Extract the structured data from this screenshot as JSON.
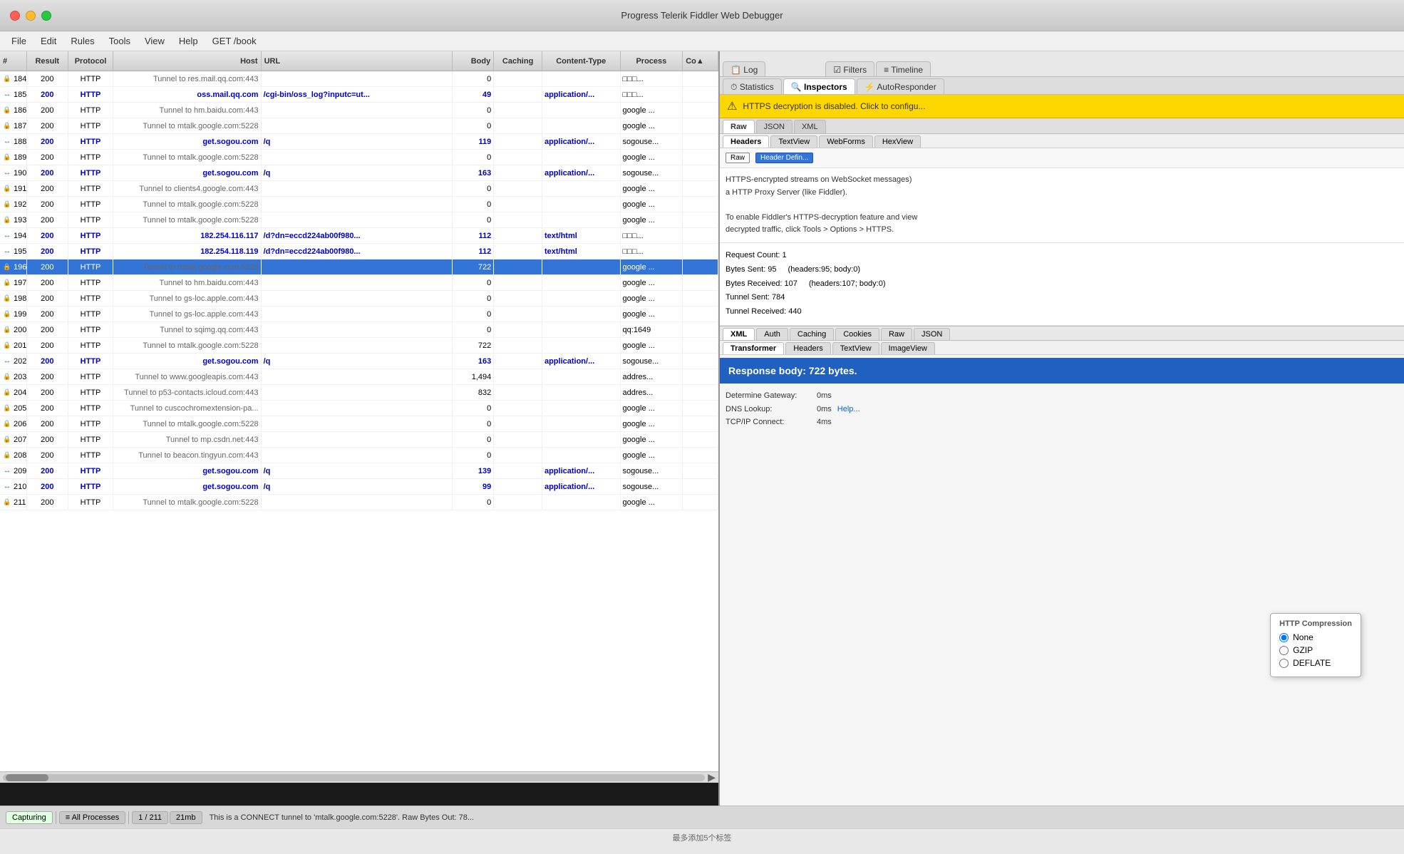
{
  "titleBar": {
    "title": "Progress Telerik Fiddler Web Debugger"
  },
  "menuBar": {
    "items": [
      "File",
      "Edit",
      "Rules",
      "Tools",
      "View",
      "Help",
      "GET /book"
    ]
  },
  "columns": {
    "headers": [
      "#",
      "Result",
      "Protocol",
      "Host",
      "URL",
      "Body",
      "Caching",
      "Content-Type",
      "Process",
      "Co▲"
    ]
  },
  "sessions": [
    {
      "num": "184",
      "result": "200",
      "protocol": "HTTP",
      "host": "Tunnel to",
      "hostDetail": "res.mail.qq.com:443",
      "url": "",
      "body": "0",
      "caching": "",
      "contentType": "",
      "process": "□□□...",
      "type": "tunnel"
    },
    {
      "num": "185",
      "result": "200",
      "protocol": "HTTP",
      "host": "oss.mail.qq.com",
      "hostDetail": "",
      "url": "/cgi-bin/oss_log?inputc=ut...",
      "body": "49",
      "caching": "",
      "contentType": "application/...",
      "process": "□□□...",
      "type": "active"
    },
    {
      "num": "186",
      "result": "200",
      "protocol": "HTTP",
      "host": "Tunnel to",
      "hostDetail": "hm.baidu.com:443",
      "url": "",
      "body": "0",
      "caching": "",
      "contentType": "",
      "process": "google ...",
      "type": "tunnel"
    },
    {
      "num": "187",
      "result": "200",
      "protocol": "HTTP",
      "host": "Tunnel to",
      "hostDetail": "mtalk.google.com:5228",
      "url": "",
      "body": "0",
      "caching": "",
      "contentType": "",
      "process": "google ...",
      "type": "tunnel"
    },
    {
      "num": "188",
      "result": "200",
      "protocol": "HTTP",
      "host": "get.sogou.com",
      "hostDetail": "",
      "url": "/q",
      "body": "119",
      "caching": "",
      "contentType": "application/...",
      "process": "sogouse...",
      "type": "active"
    },
    {
      "num": "189",
      "result": "200",
      "protocol": "HTTP",
      "host": "Tunnel to",
      "hostDetail": "mtalk.google.com:5228",
      "url": "",
      "body": "0",
      "caching": "",
      "contentType": "",
      "process": "google ...",
      "type": "tunnel"
    },
    {
      "num": "190",
      "result": "200",
      "protocol": "HTTP",
      "host": "get.sogou.com",
      "hostDetail": "",
      "url": "/q",
      "body": "163",
      "caching": "",
      "contentType": "application/...",
      "process": "sogouse...",
      "type": "active"
    },
    {
      "num": "191",
      "result": "200",
      "protocol": "HTTP",
      "host": "Tunnel to",
      "hostDetail": "clients4.google.com:443",
      "url": "",
      "body": "0",
      "caching": "",
      "contentType": "",
      "process": "google ...",
      "type": "tunnel"
    },
    {
      "num": "192",
      "result": "200",
      "protocol": "HTTP",
      "host": "Tunnel to",
      "hostDetail": "mtalk.google.com:5228",
      "url": "",
      "body": "0",
      "caching": "",
      "contentType": "",
      "process": "google ...",
      "type": "tunnel"
    },
    {
      "num": "193",
      "result": "200",
      "protocol": "HTTP",
      "host": "Tunnel to",
      "hostDetail": "mtalk.google.com:5228",
      "url": "",
      "body": "0",
      "caching": "",
      "contentType": "",
      "process": "google ...",
      "type": "tunnel"
    },
    {
      "num": "194",
      "result": "200",
      "protocol": "HTTP",
      "host": "182.254.116.117",
      "hostDetail": "",
      "url": "/d?dn=eccd224ab00f980...",
      "body": "112",
      "caching": "",
      "contentType": "text/html",
      "process": "□□□...",
      "type": "active-link"
    },
    {
      "num": "195",
      "result": "200",
      "protocol": "HTTP",
      "host": "182.254.118.119",
      "hostDetail": "",
      "url": "/d?dn=eccd224ab00f980...",
      "body": "112",
      "caching": "",
      "contentType": "text/html",
      "process": "□□□...",
      "type": "active-link"
    },
    {
      "num": "196",
      "result": "200",
      "protocol": "HTTP",
      "host": "Tunnel to",
      "hostDetail": "mtalk.google.com:5228",
      "url": "",
      "body": "722",
      "caching": "",
      "contentType": "",
      "process": "google ...",
      "type": "tunnel-selected"
    },
    {
      "num": "197",
      "result": "200",
      "protocol": "HTTP",
      "host": "Tunnel to",
      "hostDetail": "hm.baidu.com:443",
      "url": "",
      "body": "0",
      "caching": "",
      "contentType": "",
      "process": "google ...",
      "type": "tunnel"
    },
    {
      "num": "198",
      "result": "200",
      "protocol": "HTTP",
      "host": "Tunnel to",
      "hostDetail": "gs-loc.apple.com:443",
      "url": "",
      "body": "0",
      "caching": "",
      "contentType": "",
      "process": "google ...",
      "type": "tunnel"
    },
    {
      "num": "199",
      "result": "200",
      "protocol": "HTTP",
      "host": "Tunnel to",
      "hostDetail": "gs-loc.apple.com:443",
      "url": "",
      "body": "0",
      "caching": "",
      "contentType": "",
      "process": "google ...",
      "type": "tunnel"
    },
    {
      "num": "200",
      "result": "200",
      "protocol": "HTTP",
      "host": "Tunnel to",
      "hostDetail": "sqimg.qq.com:443",
      "url": "",
      "body": "0",
      "caching": "",
      "contentType": "",
      "process": "qq:1649",
      "type": "tunnel"
    },
    {
      "num": "201",
      "result": "200",
      "protocol": "HTTP",
      "host": "Tunnel to",
      "hostDetail": "mtalk.google.com:5228",
      "url": "",
      "body": "722",
      "caching": "",
      "contentType": "",
      "process": "google ...",
      "type": "tunnel"
    },
    {
      "num": "202",
      "result": "200",
      "protocol": "HTTP",
      "host": "get.sogou.com",
      "hostDetail": "",
      "url": "/q",
      "body": "163",
      "caching": "",
      "contentType": "application/...",
      "process": "sogouse...",
      "type": "active"
    },
    {
      "num": "203",
      "result": "200",
      "protocol": "HTTP",
      "host": "Tunnel to",
      "hostDetail": "www.googleapis.com:443",
      "url": "",
      "body": "1,494",
      "caching": "",
      "contentType": "",
      "process": "addres...",
      "type": "tunnel"
    },
    {
      "num": "204",
      "result": "200",
      "protocol": "HTTP",
      "host": "Tunnel to",
      "hostDetail": "p53-contacts.icloud.com:443",
      "url": "",
      "body": "832",
      "caching": "",
      "contentType": "",
      "process": "addres...",
      "type": "tunnel"
    },
    {
      "num": "205",
      "result": "200",
      "protocol": "HTTP",
      "host": "Tunnel to",
      "hostDetail": "cuscochromextension-pa...",
      "url": "",
      "body": "0",
      "caching": "",
      "contentType": "",
      "process": "google ...",
      "type": "tunnel"
    },
    {
      "num": "206",
      "result": "200",
      "protocol": "HTTP",
      "host": "Tunnel to",
      "hostDetail": "mtalk.google.com:5228",
      "url": "",
      "body": "0",
      "caching": "",
      "contentType": "",
      "process": "google ...",
      "type": "tunnel"
    },
    {
      "num": "207",
      "result": "200",
      "protocol": "HTTP",
      "host": "Tunnel to",
      "hostDetail": "mp.csdn.net:443",
      "url": "",
      "body": "0",
      "caching": "",
      "contentType": "",
      "process": "google ...",
      "type": "tunnel"
    },
    {
      "num": "208",
      "result": "200",
      "protocol": "HTTP",
      "host": "Tunnel to",
      "hostDetail": "beacon.tingyun.com:443",
      "url": "",
      "body": "0",
      "caching": "",
      "contentType": "",
      "process": "google ...",
      "type": "tunnel"
    },
    {
      "num": "209",
      "result": "200",
      "protocol": "HTTP",
      "host": "get.sogou.com",
      "hostDetail": "",
      "url": "/q",
      "body": "139",
      "caching": "",
      "contentType": "application/...",
      "process": "sogouse...",
      "type": "active"
    },
    {
      "num": "210",
      "result": "200",
      "protocol": "HTTP",
      "host": "get.sogou.com",
      "hostDetail": "",
      "url": "/q",
      "body": "99",
      "caching": "",
      "contentType": "application/...",
      "process": "sogouse...",
      "type": "active"
    },
    {
      "num": "211",
      "result": "200",
      "protocol": "HTTP",
      "host": "Tunnel to",
      "hostDetail": "mtalk.google.com:5228",
      "url": "",
      "body": "0",
      "caching": "",
      "contentType": "",
      "process": "google ...",
      "type": "tunnel"
    }
  ],
  "rightPanel": {
    "topTabs": [
      {
        "label": "Log",
        "icon": "📋",
        "active": false
      },
      {
        "label": "Filters",
        "icon": "",
        "active": false
      },
      {
        "label": "Timeline",
        "icon": "",
        "active": false
      }
    ],
    "secondTabs": [
      {
        "label": "Statistics",
        "icon": "⏱",
        "active": false
      },
      {
        "label": "Inspectors",
        "icon": "🔍",
        "active": true
      },
      {
        "label": "AutoResponder",
        "icon": "⚡",
        "active": false
      }
    ],
    "warning": "HTTPS decryption is disabled. Click to configu...",
    "topInspectorTabs": [
      "Raw",
      "JSON",
      "XML"
    ],
    "headerTabs": [
      "Headers",
      "TextView",
      "WebForms",
      "HexView"
    ],
    "activeHeaderTab": "Headers",
    "rawTags": [
      "Raw",
      "Header Defin..."
    ],
    "activeRawTag": "Header Defin...",
    "headerContent": "HTTPS-encrypted streams on WebSocket messages)\na HTTP Proxy Server (like Fiddler).",
    "httpsNote": "To enable Fiddler's HTTPS-decryption feature and view\ndecrypted traffic, click Tools > Options > HTTPS.",
    "stats": {
      "requestCount": "Request Count:  1",
      "bytesSent": "Bytes Sent:      95",
      "bytesSentDetail": "(headers:95; body:0)",
      "bytesReceived": "Bytes Received: 107",
      "bytesReceivedDetail": "(headers:107; body:0)",
      "tunnelSent": "Tunnel Sent:    784",
      "tunnelReceived": "Tunnel Received: 440"
    },
    "bottomTabs": [
      "XML",
      "Auth",
      "Caching",
      "Cookies",
      "Raw",
      "JSON"
    ],
    "transformerTabs": [
      "Transformer",
      "Headers",
      "TextView",
      "ImageView"
    ],
    "activeTransformerTab": "Transformer",
    "responseBody": "Response body: 722 bytes.",
    "timings": {
      "gateway": "Determine Gateway:    0ms",
      "dns": "DNS Lookup:    0ms",
      "tcpConnect": "TCP/IP Connect:  4ms"
    },
    "helpLink": "Help...",
    "compression": {
      "title": "HTTP Compression",
      "options": [
        "None",
        "GZIP",
        "DEFLATE"
      ],
      "selected": "None"
    }
  },
  "statusBar": {
    "capturing": "Capturing",
    "processes": "All Processes",
    "position": "1 / 211",
    "size": "21mb",
    "message": "This is a CONNECT tunnel to 'mtalk.google.com:5228'. Raw Bytes Out: 78..."
  },
  "bottomLabel": "最多添加5个标签"
}
